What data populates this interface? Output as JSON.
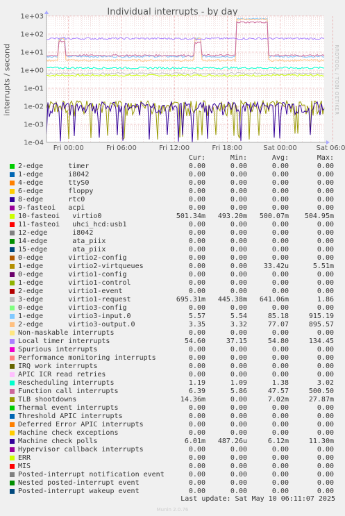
{
  "title": "Individual interrupts - by day",
  "side_label": "RRDTOOL / TOBI OETIKER",
  "footer": {
    "last_update": "Last update: Sat May 10 06:11:07 2025",
    "version": "Munin 2.0.76"
  },
  "legend_headers": {
    "cur": "Cur:",
    "min": "Min:",
    "avg": "Avg:",
    "max": "Max:"
  },
  "legend": [
    {
      "name": "2-edge      timer",
      "color": "#00cc00",
      "cur": "0.00",
      "min": "0.00",
      "avg": "0.00",
      "max": "0.00"
    },
    {
      "name": "1-edge      i8042",
      "color": "#0066b3",
      "cur": "0.00",
      "min": "0.00",
      "avg": "0.00",
      "max": "0.00"
    },
    {
      "name": "4-edge      ttyS0",
      "color": "#ff8000",
      "cur": "0.00",
      "min": "0.00",
      "avg": "0.00",
      "max": "0.00"
    },
    {
      "name": "6-edge      floppy",
      "color": "#ffcc00",
      "cur": "0.00",
      "min": "0.00",
      "avg": "0.00",
      "max": "0.00"
    },
    {
      "name": "8-edge      rtc0",
      "color": "#330099",
      "cur": "0.00",
      "min": "0.00",
      "avg": "0.00",
      "max": "0.00"
    },
    {
      "name": "9-fasteoi   acpi",
      "color": "#990099",
      "cur": "0.00",
      "min": "0.00",
      "avg": "0.00",
      "max": "0.00"
    },
    {
      "name": "10-fasteoi   virtio0",
      "color": "#ccff00",
      "cur": "501.34m",
      "min": "493.20m",
      "avg": "500.07m",
      "max": "504.95m"
    },
    {
      "name": "11-fasteoi   uhci_hcd:usb1",
      "color": "#ff0000",
      "cur": "0.00",
      "min": "0.00",
      "avg": "0.00",
      "max": "0.00"
    },
    {
      "name": "12-edge      i8042",
      "color": "#808080",
      "cur": "0.00",
      "min": "0.00",
      "avg": "0.00",
      "max": "0.00"
    },
    {
      "name": "14-edge      ata_piix",
      "color": "#008f00",
      "cur": "0.00",
      "min": "0.00",
      "avg": "0.00",
      "max": "0.00"
    },
    {
      "name": "15-edge      ata_piix",
      "color": "#00487d",
      "cur": "0.00",
      "min": "0.00",
      "avg": "0.00",
      "max": "0.00"
    },
    {
      "name": "0-edge      virtio2-config",
      "color": "#b35a00",
      "cur": "0.00",
      "min": "0.00",
      "avg": "0.00",
      "max": "0.00"
    },
    {
      "name": "1-edge      virtio2-virtqueues",
      "color": "#b38f00",
      "cur": "0.00",
      "min": "0.00",
      "avg": "33.42u",
      "max": "5.51m"
    },
    {
      "name": "0-edge      virtio1-config",
      "color": "#6b006b",
      "cur": "0.00",
      "min": "0.00",
      "avg": "0.00",
      "max": "0.00"
    },
    {
      "name": "1-edge      virtio1-control",
      "color": "#8fb300",
      "cur": "0.00",
      "min": "0.00",
      "avg": "0.00",
      "max": "0.00"
    },
    {
      "name": "2-edge      virtio1-event",
      "color": "#b30000",
      "cur": "0.00",
      "min": "0.00",
      "avg": "0.00",
      "max": "0.00"
    },
    {
      "name": "3-edge      virtio1-request",
      "color": "#bebebe",
      "cur": "695.31m",
      "min": "445.38m",
      "avg": "641.06m",
      "max": "1.86"
    },
    {
      "name": "0-edge      virtio3-config",
      "color": "#80ff80",
      "cur": "0.00",
      "min": "0.00",
      "avg": "0.00",
      "max": "0.00"
    },
    {
      "name": "1-edge      virtio3-input.0",
      "color": "#80c9ff",
      "cur": "5.57",
      "min": "5.54",
      "avg": "85.18",
      "max": "915.19"
    },
    {
      "name": "2-edge      virtio3-output.0",
      "color": "#ffc080",
      "cur": "3.35",
      "min": "3.32",
      "avg": "77.07",
      "max": "895.57"
    },
    {
      "name": "Non-maskable interrupts",
      "color": "#ffe680",
      "cur": "0.00",
      "min": "0.00",
      "avg": "0.00",
      "max": "0.00"
    },
    {
      "name": "Local timer interrupts",
      "color": "#aa80ff",
      "cur": "54.60",
      "min": "37.15",
      "avg": "54.80",
      "max": "134.45"
    },
    {
      "name": "Spurious interrupts",
      "color": "#ee00cc",
      "cur": "0.00",
      "min": "0.00",
      "avg": "0.00",
      "max": "0.00"
    },
    {
      "name": "Performance monitoring interrupts",
      "color": "#ff8080",
      "cur": "0.00",
      "min": "0.00",
      "avg": "0.00",
      "max": "0.00"
    },
    {
      "name": "IRQ work interrupts",
      "color": "#666600",
      "cur": "0.00",
      "min": "0.00",
      "avg": "0.00",
      "max": "0.00"
    },
    {
      "name": "APIC ICR read retries",
      "color": "#ffbfff",
      "cur": "0.00",
      "min": "0.00",
      "avg": "0.00",
      "max": "0.00"
    },
    {
      "name": "Rescheduling interrupts",
      "color": "#00ffcc",
      "cur": "1.19",
      "min": "1.09",
      "avg": "1.38",
      "max": "3.02"
    },
    {
      "name": "Function call interrupts",
      "color": "#cc6699",
      "cur": "6.39",
      "min": "5.86",
      "avg": "47.57",
      "max": "500.50"
    },
    {
      "name": "TLB shootdowns",
      "color": "#999900",
      "cur": "14.36m",
      "min": "0.00",
      "avg": "7.02m",
      "max": "27.87m"
    },
    {
      "name": "Thermal event interrupts",
      "color": "#00cc00",
      "cur": "0.00",
      "min": "0.00",
      "avg": "0.00",
      "max": "0.00"
    },
    {
      "name": "Threshold APIC interrupts",
      "color": "#0066b3",
      "cur": "0.00",
      "min": "0.00",
      "avg": "0.00",
      "max": "0.00"
    },
    {
      "name": "Deferred Error APIC interrupts",
      "color": "#ff8000",
      "cur": "0.00",
      "min": "0.00",
      "avg": "0.00",
      "max": "0.00"
    },
    {
      "name": "Machine check exceptions",
      "color": "#ffcc00",
      "cur": "0.00",
      "min": "0.00",
      "avg": "0.00",
      "max": "0.00"
    },
    {
      "name": "Machine check polls",
      "color": "#330099",
      "cur": "6.01m",
      "min": "487.26u",
      "avg": "6.12m",
      "max": "11.30m"
    },
    {
      "name": "Hypervisor callback interrupts",
      "color": "#990099",
      "cur": "0.00",
      "min": "0.00",
      "avg": "0.00",
      "max": "0.00"
    },
    {
      "name": "ERR",
      "color": "#ccff00",
      "cur": "0.00",
      "min": "0.00",
      "avg": "0.00",
      "max": "0.00"
    },
    {
      "name": "MIS",
      "color": "#ff0000",
      "cur": "0.00",
      "min": "0.00",
      "avg": "0.00",
      "max": "0.00"
    },
    {
      "name": "Posted-interrupt notification event",
      "color": "#808080",
      "cur": "0.00",
      "min": "0.00",
      "avg": "0.00",
      "max": "0.00"
    },
    {
      "name": "Nested posted-interrupt event",
      "color": "#008f00",
      "cur": "0.00",
      "min": "0.00",
      "avg": "0.00",
      "max": "0.00"
    },
    {
      "name": "Posted-interrupt wakeup event",
      "color": "#00487d",
      "cur": "0.00",
      "min": "0.00",
      "avg": "0.00",
      "max": "0.00"
    }
  ],
  "chart_data": {
    "type": "line",
    "title": "Individual interrupts - by day",
    "ylabel": "interrupts / second",
    "yscale": "log",
    "ylim": [
      0.0001,
      1000
    ],
    "ytick_labels": [
      "1e-04",
      "1e-03",
      "1e-02",
      "1e-01",
      "1e+00",
      "1e+01",
      "1e+02",
      "1e+03"
    ],
    "xtick_labels": [
      "Fri 00:00",
      "Fri 06:00",
      "Fri 12:00",
      "Fri 18:00",
      "Sat 00:00",
      "Sat 06:00"
    ],
    "grid": true,
    "series": [
      {
        "name": "10-fasteoi   virtio0",
        "color": "#ccff00",
        "level": 0.5
      },
      {
        "name": "3-edge      virtio1-request",
        "color": "#bebebe",
        "level": 0.64
      },
      {
        "name": "1-edge      virtio3-input.0",
        "color": "#80c9ff",
        "level": 5.6,
        "burst": 700
      },
      {
        "name": "2-edge      virtio3-output.0",
        "color": "#ffc080",
        "level": 3.4,
        "burst": 650
      },
      {
        "name": "Local timer interrupts",
        "color": "#aa80ff",
        "level": 55
      },
      {
        "name": "Rescheduling interrupts",
        "color": "#00ffcc",
        "level": 1.3
      },
      {
        "name": "Function call interrupts",
        "color": "#cc6699",
        "level": 6.4,
        "burst": 450
      },
      {
        "name": "TLB shootdowns",
        "color": "#999900",
        "level": 0.007
      },
      {
        "name": "Machine check polls",
        "color": "#330099",
        "level": 0.006
      }
    ]
  }
}
